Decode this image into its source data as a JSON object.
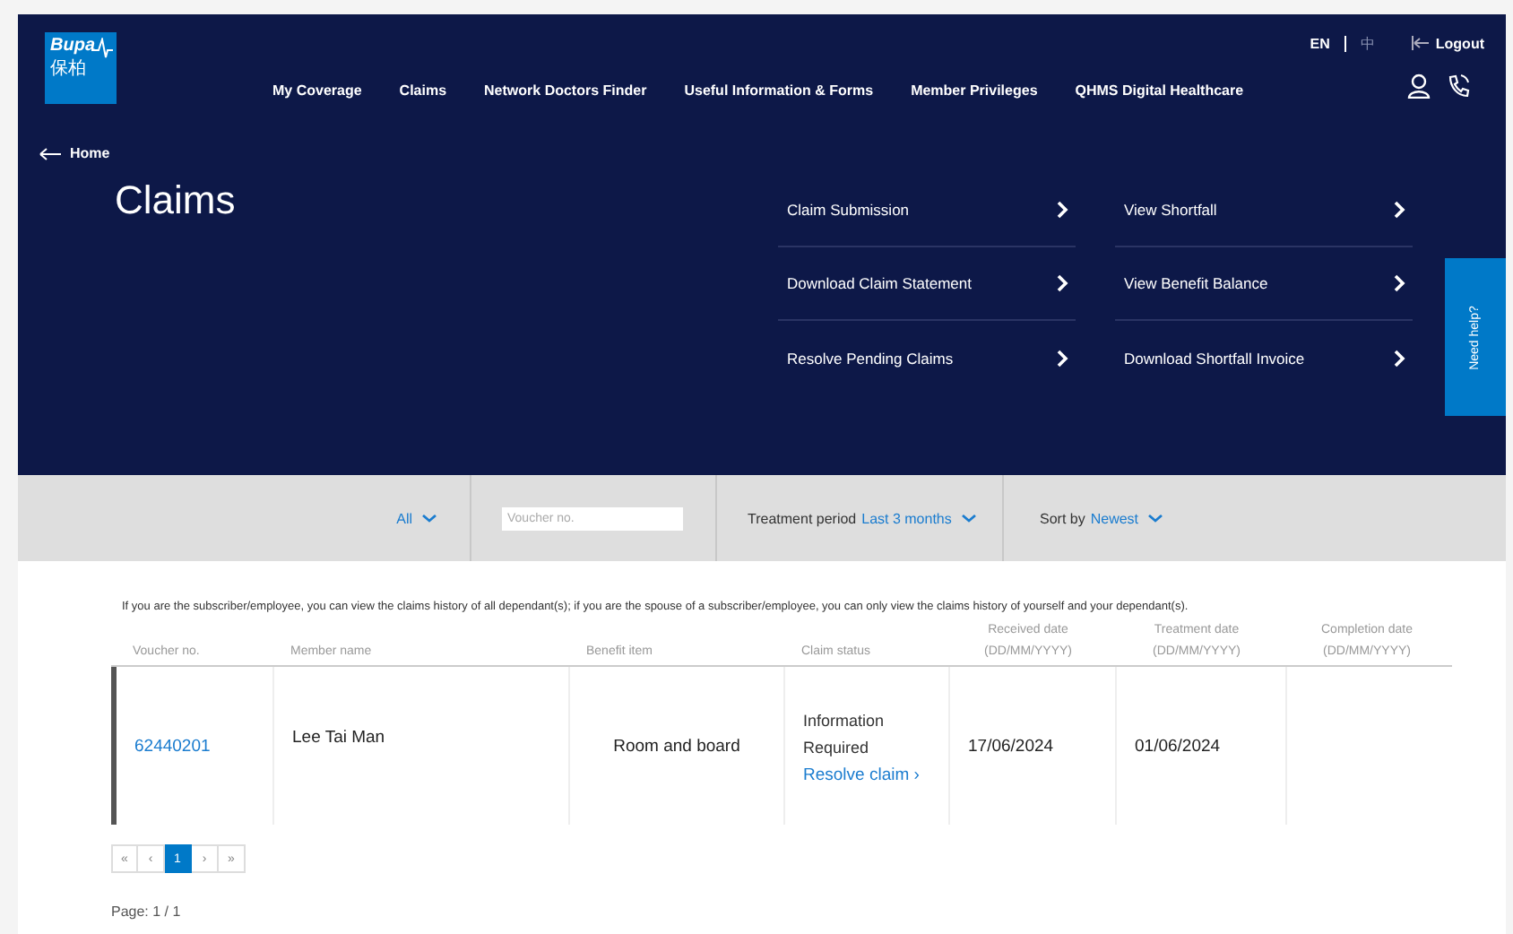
{
  "header": {
    "logo": {
      "line_1": "Bupa",
      "line_2": "保柏"
    },
    "languages": [
      {
        "label": "EN",
        "selected": true
      },
      {
        "label": "中",
        "selected": false
      }
    ],
    "logout": "Logout",
    "nav": [
      "My Coverage",
      "Claims",
      "Network Doctors Finder",
      "Useful Information & Forms",
      "Member Privileges",
      "QHMS Digital Healthcare"
    ],
    "back_link": "Home"
  },
  "page_title": "Claims",
  "quick_links": [
    {
      "label": "Claim Submission"
    },
    {
      "label": "View Shortfall"
    },
    {
      "label": "Download Claim Statement"
    },
    {
      "label": "View Benefit Balance"
    },
    {
      "label": "Resolve Pending Claims"
    },
    {
      "label": "Download Shortfall Invoice"
    }
  ],
  "help_tab": "Need help?",
  "filters": {
    "member": "All",
    "voucher": {
      "placeholder": "Voucher no."
    },
    "period_label": "Treatment period",
    "period": "Last 3 months",
    "sort_label": "Sort by",
    "sort": "Newest"
  },
  "note": "If you are the subscriber/employee, you can view the claims history of all dependant(s); if you are the spouse of a subscriber/employee, you can only view the claims history of yourself and your dependant(s).",
  "table": {
    "columns": [
      {
        "label": "Voucher no."
      },
      {
        "label": "Member name"
      },
      {
        "label": "Benefit item"
      },
      {
        "label": "Claim status"
      },
      {
        "label": "Received date",
        "sub": "(DD/MM/YYYY)"
      },
      {
        "label": "Treatment date",
        "sub": "(DD/MM/YYYY)"
      },
      {
        "label": "Completion date",
        "sub": "(DD/MM/YYYY)"
      }
    ],
    "rows": [
      {
        "voucher": "62440201",
        "member": "Lee Tai Man",
        "benefit": "Room and board",
        "status": "Information Required",
        "action": "Resolve claim ›",
        "received": "17/06/2024",
        "treatment": "01/06/2024"
      }
    ]
  },
  "pagination": {
    "buttons": [
      {
        "label": "«",
        "selected": false
      },
      {
        "label": "‹",
        "selected": false
      },
      {
        "label": "1",
        "selected": true
      },
      {
        "label": "›",
        "selected": false
      },
      {
        "label": "»",
        "selected": false
      }
    ],
    "page_info": "Page: 1 / 1"
  }
}
